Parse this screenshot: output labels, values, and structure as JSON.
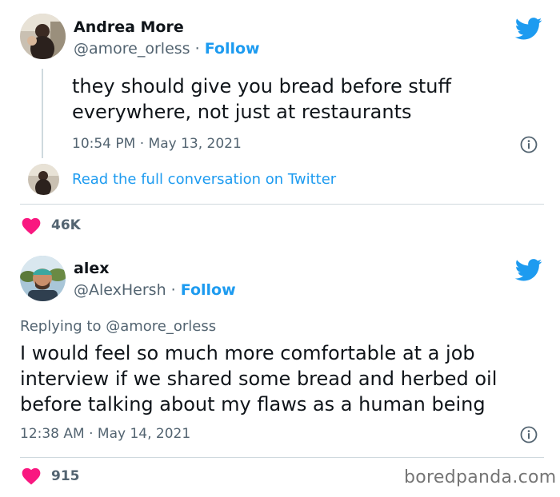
{
  "tweet1": {
    "author_name": "Andrea More",
    "author_handle": "@amore_orless",
    "separator": " · ",
    "follow_label": "Follow",
    "text_line1": "they should give you bread before stuff",
    "text_line2": "everywhere, not just at restaurants",
    "timestamp": "10:54 PM · May 13, 2021",
    "read_more": "Read the full conversation on Twitter",
    "likes": "46K"
  },
  "tweet2": {
    "author_name": "alex",
    "author_handle": "@AlexHersh",
    "separator": " · ",
    "follow_label": "Follow",
    "reply_prefix": "Replying to ",
    "reply_handle": "@amore_orless",
    "text_line1": "I would feel so much more comfortable at a job",
    "text_line2": "interview if we shared some bread and herbed oil",
    "text_line3": "before talking about my flaws as a human being",
    "timestamp": "12:38 AM · May 14, 2021",
    "likes": "915"
  },
  "watermark": "boredpanda.com",
  "icons": {
    "twitter": "twitter-bird-icon",
    "info": "info-icon",
    "like": "heart-icon"
  },
  "colors": {
    "twitter_blue": "#1d9bf0",
    "heart_red": "#f91880",
    "secondary_text": "#536471"
  }
}
